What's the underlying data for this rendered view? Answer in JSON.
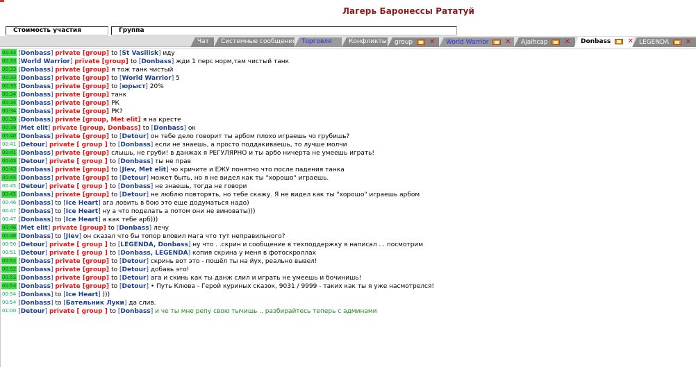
{
  "window": {
    "title": "Лагерь Баронессы Рататуй"
  },
  "subtabs": [
    {
      "label": "Стоимость участия"
    },
    {
      "label": "Группа"
    }
  ],
  "tabs": [
    {
      "label": "Чат"
    },
    {
      "label": "Системные сообщения"
    },
    {
      "label": "Торговля"
    },
    {
      "label": "Конфликты"
    },
    {
      "label": "group"
    },
    {
      "label": "World Warrior"
    },
    {
      "label": "Ajaihcap"
    },
    {
      "label": "Donbass"
    },
    {
      "label": "LEGENDA"
    }
  ],
  "chat": {
    "messages": [
      {
        "time": "00:33",
        "from": "Donbass",
        "priv": "group",
        "to": "St Vasilisk",
        "text": "иду"
      },
      {
        "time": "00:33",
        "from": "World Warrior",
        "priv": "group",
        "to": "Donbass",
        "text": "жди 1 перс норм,там чистый танк"
      },
      {
        "time": "00:33",
        "from": "Donbass",
        "priv": "group",
        "text": "я тож танк чистый"
      },
      {
        "time": "00:33",
        "from": "Donbass",
        "priv": "group",
        "to": "World Warrior",
        "text": "5"
      },
      {
        "time": "00:33",
        "from": "Donbass",
        "priv": "group",
        "to": "юрыст",
        "text": "20%"
      },
      {
        "time": "00:34",
        "from": "Donbass",
        "priv": "group",
        "text": "танк"
      },
      {
        "time": "00:34",
        "from": "Donbass",
        "priv": "group",
        "text": "РК"
      },
      {
        "time": "00:34",
        "from": "Donbass",
        "priv": "group",
        "text": "РК?"
      },
      {
        "time": "00:39",
        "from": "Donbass",
        "priv": "group, Met elit",
        "text": "я на кресте"
      },
      {
        "time": "00:39",
        "from": "Met elit",
        "priv": "group, Donbass",
        "to": "Donbass",
        "text": "ок"
      },
      {
        "time": "00:40",
        "from": "Donbass",
        "priv": "group",
        "to": "Detour",
        "text": "он тебе дело говорит ты арбом плохо играешь чо грубишь?"
      },
      {
        "time": "00:41",
        "from": "Detour",
        "priv": " group ",
        "to": "Donbass",
        "text": "если не знаешь, а просто поддакиваешь, то лучше молчи"
      },
      {
        "time": "00:41",
        "from": "Donbass",
        "priv": "group",
        "text": "слышь, не груби! в данжах я РЕГУЛЯРНО и ты арбо ничерта не умеешь играть!"
      },
      {
        "time": "00:43",
        "from": "Detour",
        "priv": " group ",
        "to": "Donbass",
        "text": "ты не прав"
      },
      {
        "time": "00:43",
        "from": "Donbass",
        "priv": "group",
        "to": "JIev, Met elit",
        "text": "чо кричите и ЕЖУ понятно что после падения танка"
      },
      {
        "time": "00:44",
        "from": "Donbass",
        "priv": "group",
        "to": "Detour",
        "text": "может быть, но я не видел как ты \"хорошо\" играешь."
      },
      {
        "time": "00:45",
        "from": "Detour",
        "priv": " group ",
        "to": "Donbass",
        "text": "не знаешь, тогда не говори"
      },
      {
        "time": "00:45",
        "from": "Donbass",
        "priv": "group",
        "to": "Detour",
        "text": "не люблю повторять, но тебе скажу. Я не видел как ты \"хорошо\" играешь арбом"
      },
      {
        "time": "00:46",
        "from": "Donbass",
        "to": "Ice Heart",
        "text": "ага ловить в бою это еще додуматься надо)"
      },
      {
        "time": "00:47",
        "from": "Donbass",
        "to": "Ice Heart",
        "text": "ну а что поделать а потом они не виноваты)))"
      },
      {
        "time": "00:47",
        "from": "Donbass",
        "to": "Ice Heart",
        "text": "а как тебе арб)))"
      },
      {
        "time": "00:48",
        "from": "Met elit",
        "priv": "group",
        "to": "Donbass",
        "text": "лечу"
      },
      {
        "time": "00:48",
        "from": "Donbass",
        "to": "JIev",
        "text": "он сказал что бы топор вловил мага что тут неправильного?"
      },
      {
        "time": "00:50",
        "from": "Detour",
        "priv": " group ",
        "to": "LEGENDA, Donbass",
        "text": "ну что . .скрин и сообщение в техподдержку я написал . . посмотрим"
      },
      {
        "time": "00:51",
        "from": "Detour",
        "priv": " group ",
        "to": "Donbass, LEGENDA",
        "text": "копия скрина у меня в фотоскроллах"
      },
      {
        "time": "00:52",
        "from": "Donbass",
        "priv": "group",
        "to": "Detour",
        "text": "скринь вот это - пошёл ты на йух, реально вывел!"
      },
      {
        "time": "00:52",
        "from": "Donbass",
        "priv": "group",
        "to": "Detour",
        "text": "добавь это!"
      },
      {
        "time": "00:53",
        "from": "Donbass",
        "priv": "group",
        "to": "Detour",
        "text": "ага и скинь как ты данж слил и играть не умеешь и бочинишь!"
      },
      {
        "time": "00:53",
        "from": "Donbass",
        "priv": "group",
        "to": "Detour",
        "text": "• Путь Клюва - Герой куриных сказок, 9031 / 9999 - таких как ты я уже насмотрелся!"
      },
      {
        "time": "00:54",
        "from": "Donbass",
        "to": "Ice Heart",
        "text": ")))"
      },
      {
        "time": "00:54",
        "from": "Donbass",
        "to": "Ба­тельник Луки",
        "text": "да слив."
      },
      {
        "time": "01:00",
        "from": "Detour",
        "priv": " group ",
        "to": "Donbass",
        "text": "и че ты мне репу свою тычишь .. разбирайтесь теперь с админами"
      }
    ]
  },
  "strings": {
    "private": "private",
    "to": "to"
  }
}
